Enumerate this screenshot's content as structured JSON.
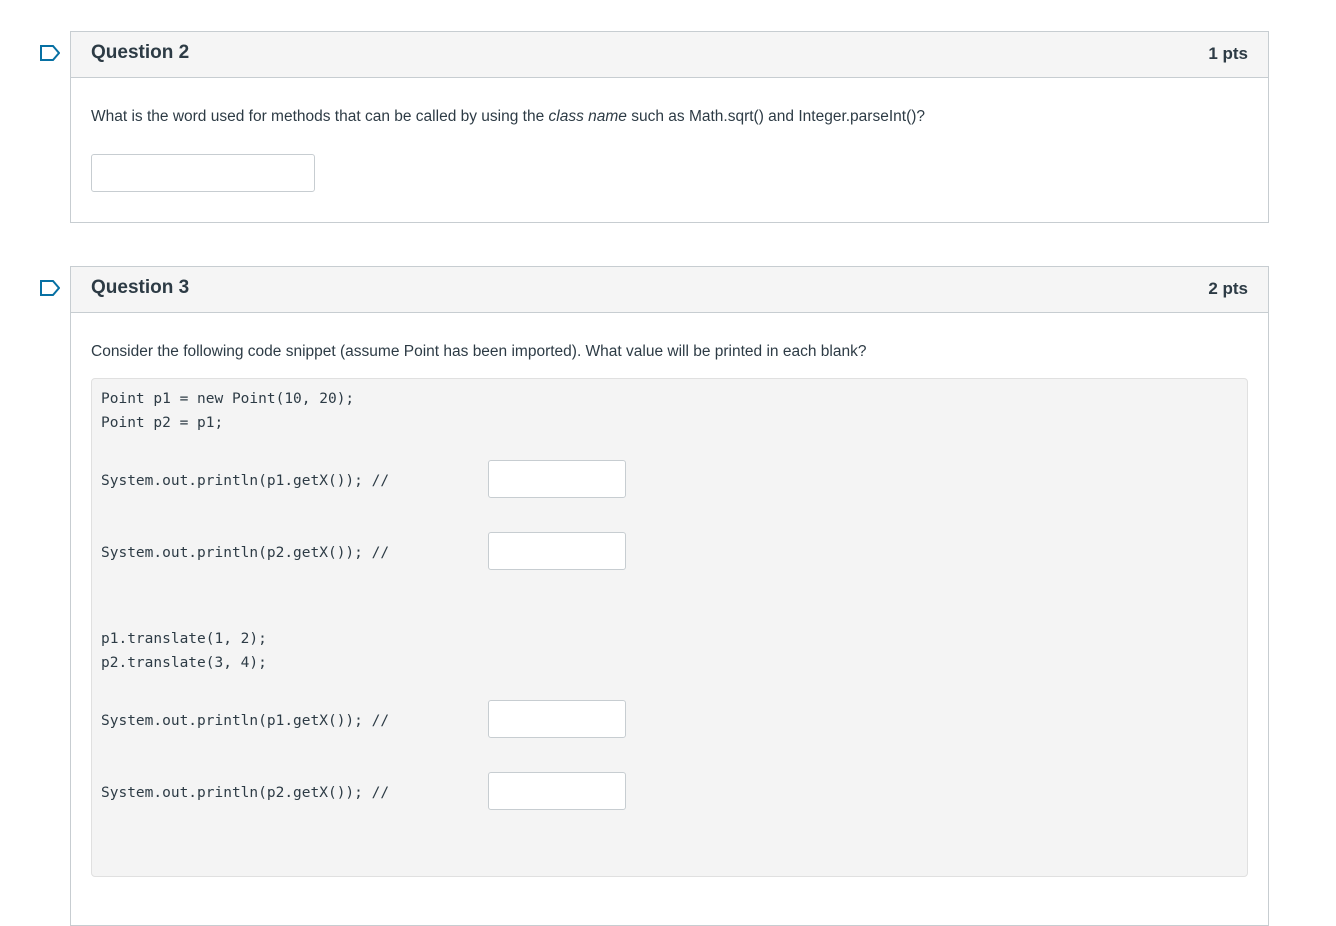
{
  "questions": [
    {
      "title": "Question 2",
      "points": "1 pts",
      "text_before": "What is the word used for methods that can be called by using the ",
      "text_em": "class name",
      "text_after": " such as Math.sqrt() and Integer.parseInt()?",
      "answer_value": ""
    },
    {
      "title": "Question 3",
      "points": "2 pts",
      "text": "Consider the following code snippet (assume Point has been imported). What value will be printed in each blank?",
      "code": {
        "line1": "Point p1 = new Point(10, 20);",
        "line2": "Point p2 = p1;",
        "line3": "System.out.println(p1.getX()); //",
        "line4": "System.out.println(p2.getX()); //",
        "line5": "p1.translate(1, 2);",
        "line6": "p2.translate(3, 4);",
        "line7": "System.out.println(p1.getX()); //",
        "line8": "System.out.println(p2.getX()); //"
      },
      "blanks": [
        "",
        "",
        "",
        ""
      ]
    }
  ],
  "colors": {
    "border": "#c7cdd1",
    "header_bg": "#f5f5f5",
    "code_bg": "#f4f4f4",
    "flag_blue": "#0770a3",
    "text": "#2d3b45"
  }
}
